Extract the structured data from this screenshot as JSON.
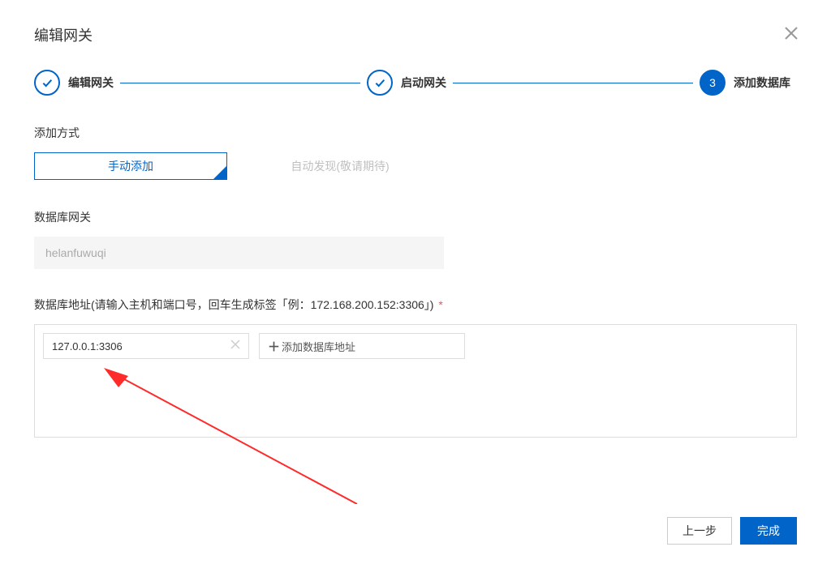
{
  "dialog": {
    "title": "编辑网关"
  },
  "stepper": {
    "step1": {
      "label": "编辑网关"
    },
    "step2": {
      "label": "启动网关"
    },
    "step3": {
      "label": "添加数据库",
      "number": "3"
    }
  },
  "addMethod": {
    "label": "添加方式",
    "options": {
      "manual": "手动添加",
      "auto": "自动发现(敬请期待)"
    }
  },
  "gateway": {
    "label": "数据库网关",
    "value": "helanfuwuqi"
  },
  "dbAddress": {
    "label": "数据库地址(请输入主机和端口号，回车生成标签「例：172.168.200.152:3306」)",
    "required": "*",
    "tags": [
      "127.0.0.1:3306"
    ],
    "placeholder": "添加数据库地址"
  },
  "footer": {
    "prev": "上一步",
    "done": "完成"
  }
}
